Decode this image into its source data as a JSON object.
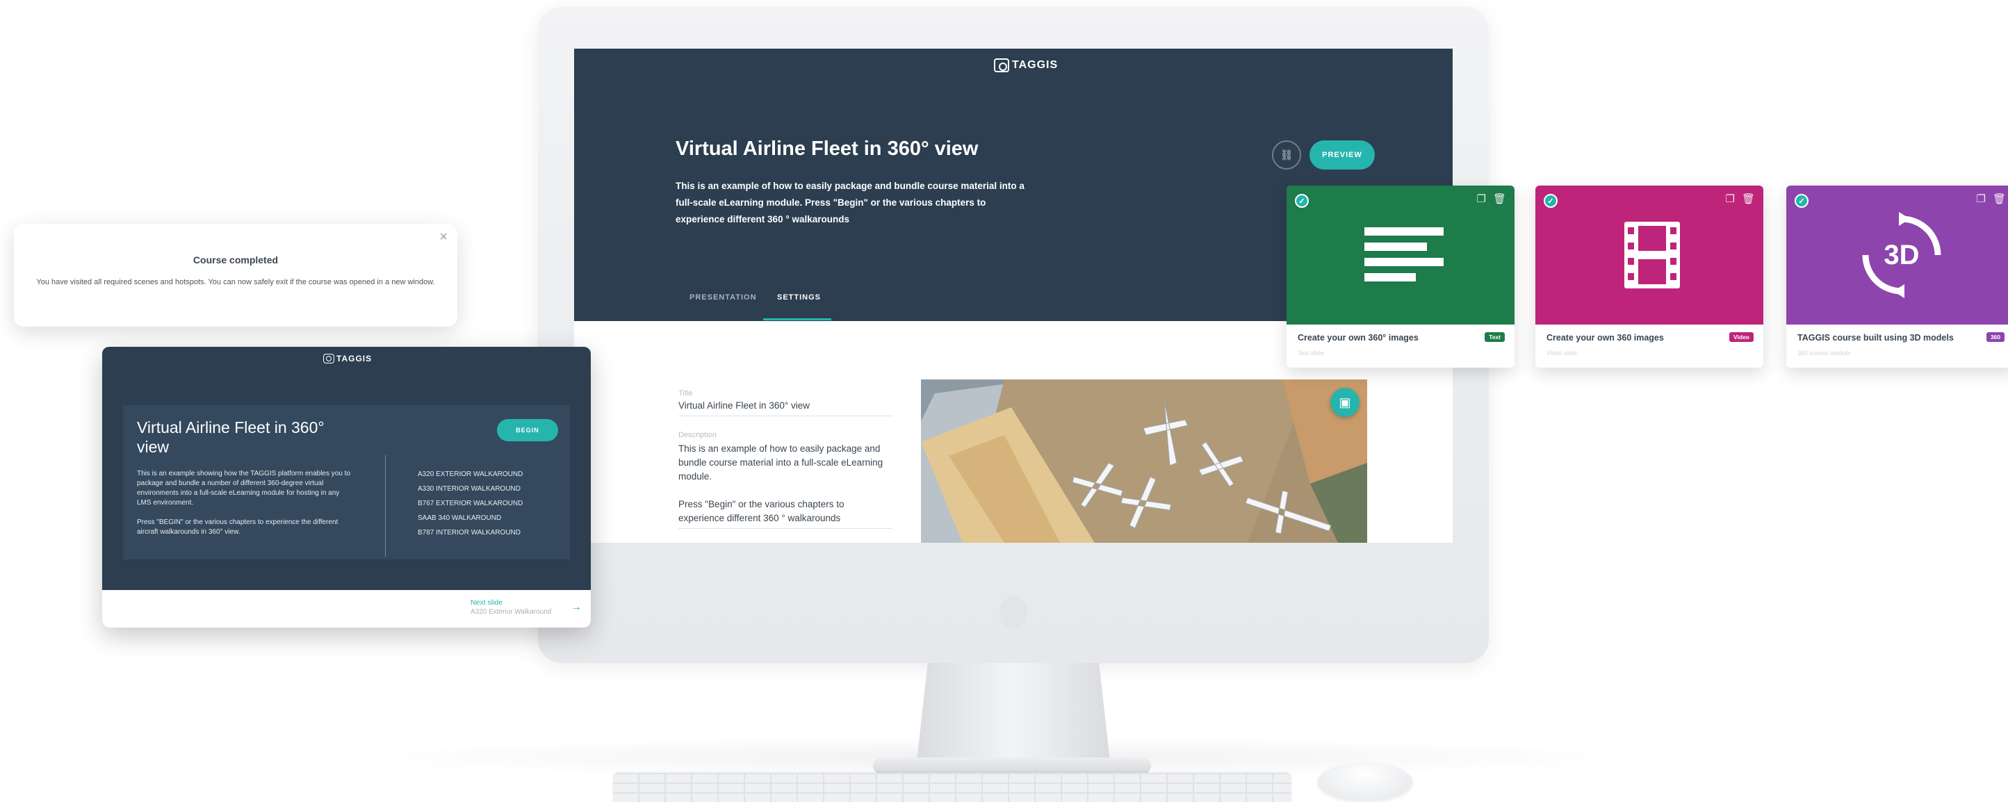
{
  "screen": {
    "brand": "TAGGIS",
    "hero_title": "Virtual Airline Fleet in 360° view",
    "hero_description": "This is an example of how to easily package and bundle course material into a full-scale eLearning module. Press \"Begin\" or the various chapters to experience different 360 ° walkarounds",
    "preview_label": "PREVIEW",
    "tabs": [
      {
        "label": "PRESENTATION",
        "active": false
      },
      {
        "label": "SETTINGS",
        "active": true
      }
    ],
    "form": {
      "title_label": "Title",
      "title_value": "Virtual Airline Fleet in 360° view",
      "description_label": "Description",
      "description_p1": "This is an example of how to easily package and bundle course material into a full-scale eLearning module.",
      "description_p2": "Press \"Begin\" or the various chapters to experience different 360 ° walkarounds"
    },
    "accent_color": "#26b5ac",
    "hero_color": "#2c3e50"
  },
  "cards": [
    {
      "title": "Create your own 360° images",
      "badge": "Text",
      "subtitle": "Text slide",
      "color": "#1e7b4a",
      "icon": "text-lines-icon"
    },
    {
      "title": "Create your own 360 images",
      "badge": "Video",
      "subtitle": "Video slide",
      "color": "#be2479",
      "icon": "film-icon"
    },
    {
      "title": "TAGGIS course built using 3D models",
      "badge": "360",
      "subtitle": "360 course module",
      "color": "#8e44ad",
      "icon": "3d-rotate-icon",
      "icon_text": "3D"
    }
  ],
  "popup": {
    "title": "Course completed",
    "text": "You have visited all required scenes and hotspots. You can now safely exit if the course was opened in a new window."
  },
  "tablet": {
    "brand": "TAGGIS",
    "title": "Virtual Airline Fleet in 360° view",
    "begin_label": "BEGIN",
    "description_p1": "This is an example showing how the TAGGIS platform enables you to package and bundle a number of different 360-degree virtual environments into a full-scale eLearning module for hosting in any LMS environment.",
    "description_p2": "Press \"BEGIN\" or the various chapters to experience the different aircraft walkarounds in 360° view.",
    "chapters": [
      "A320 EXTERIOR WALKAROUND",
      "A330 INTERIOR WALKAROUND",
      "B767 EXTERIOR WALKAROUND",
      "SAAB 340 WALKAROUND",
      "B787 INTERIOR WALKAROUND"
    ],
    "next_label": "Next slide",
    "next_name": "A320 Exterior Walkaround"
  }
}
